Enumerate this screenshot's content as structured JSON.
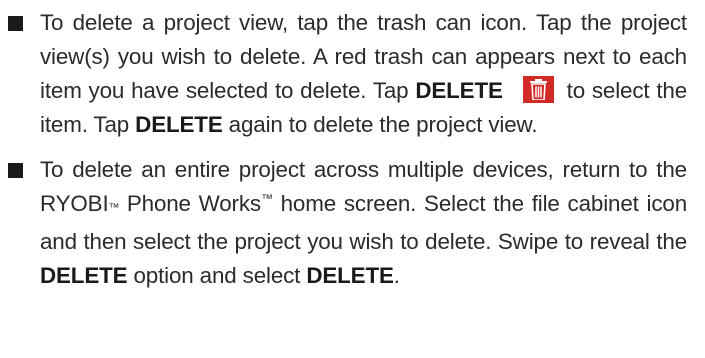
{
  "items": [
    {
      "t1": "To delete a project view, tap the trash can icon. Tap the project view(s) you wish to delete. A red trash can ap­pears next to each item you have selected to delete. Tap ",
      "b1": "DELETE",
      "icon": "red-trash-can-icon",
      "t2": " to select the item. Tap ",
      "b2": "DELETE",
      "t3": " again to delete the project view."
    },
    {
      "t1": "To delete an entire project across multiple devices, return to the RYOBI",
      "tm1": "™",
      "t2": " Phone Works",
      "tm2": "™",
      "t3": " home screen. Select the file cabinet icon and then select the project you wish to delete. Swipe to reveal the ",
      "b1": "DELETE",
      "t4": " option and select ",
      "b2": "DELETE",
      "t5": "."
    }
  ],
  "colors": {
    "text": "#2b2b2b",
    "trash_bg": "#d32a26"
  }
}
